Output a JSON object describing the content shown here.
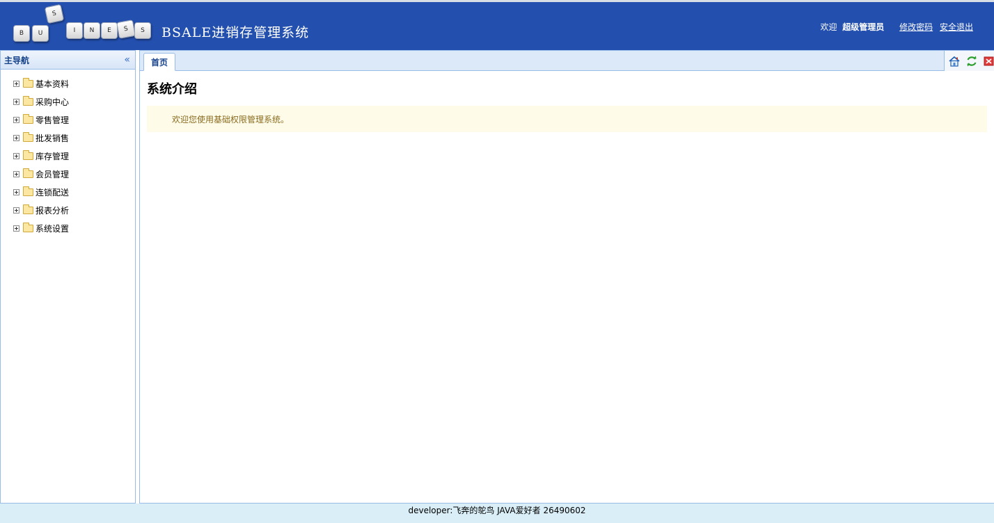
{
  "header": {
    "logo_letters": [
      "B",
      "U",
      "S",
      "I",
      "N",
      "E",
      "S",
      "S"
    ],
    "app_title": "BSALE进销存管理系统",
    "welcome_text": "欢迎",
    "username": "超级管理员",
    "change_password_label": "修改密码",
    "logout_label": "安全退出"
  },
  "sidebar": {
    "title": "主导航",
    "items": [
      {
        "label": "基本资料"
      },
      {
        "label": "采购中心"
      },
      {
        "label": "零售管理"
      },
      {
        "label": "批发销售"
      },
      {
        "label": "库存管理"
      },
      {
        "label": "会员管理"
      },
      {
        "label": "连锁配送"
      },
      {
        "label": "报表分析"
      },
      {
        "label": "系统设置"
      }
    ]
  },
  "main": {
    "tabs": [
      {
        "label": "首页"
      }
    ],
    "tools": [
      "home-icon",
      "refresh-icon",
      "close-icon"
    ],
    "page_title": "系统介绍",
    "welcome_message": "欢迎您使用基础权限管理系统。"
  },
  "footer": {
    "text": "developer:飞奔的鸵鸟 JAVA爱好者 26490602"
  },
  "colors": {
    "header_bg": "#234fae",
    "border": "#99bbe8",
    "footer_bg": "#d9eef6",
    "notice_bg": "#fefce8"
  }
}
